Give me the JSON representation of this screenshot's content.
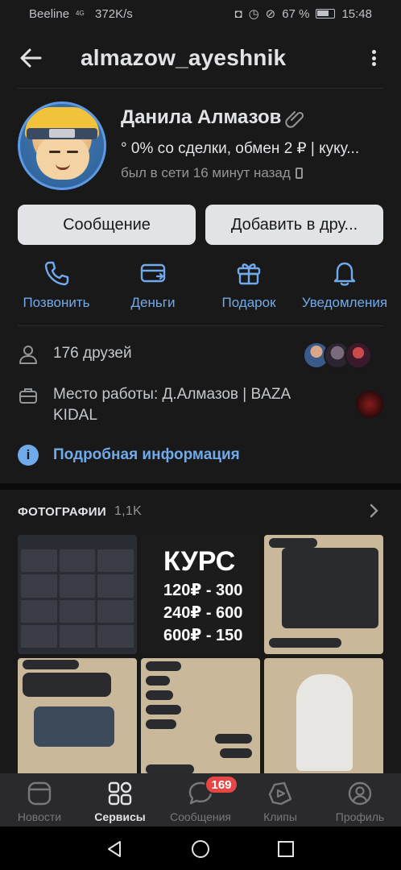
{
  "status_bar": {
    "carrier": "Beeline",
    "network": "4G",
    "speed": "372K/s",
    "battery": "67 %",
    "time": "15:48"
  },
  "header": {
    "title": "almazow_ayeshnik"
  },
  "profile": {
    "name": "Данила Алмазов",
    "status": "° 0% со сделки, обмен 2 ₽ | куку...",
    "last_seen": "был в сети 16 минут назад"
  },
  "buttons": {
    "message": "Сообщение",
    "add_friend": "Добавить в дру..."
  },
  "actions": [
    {
      "label": "Позвонить",
      "icon": "phone-icon"
    },
    {
      "label": "Деньги",
      "icon": "money-icon"
    },
    {
      "label": "Подарок",
      "icon": "gift-icon"
    },
    {
      "label": "Уведомления",
      "icon": "bell-icon"
    }
  ],
  "info": {
    "friends": "176 друзей",
    "work": "Место работы: Д.Алмазов | BAZA KIDAL",
    "details_link": "Подробная информация"
  },
  "photos": {
    "heading": "ФОТОГРАФИИ",
    "count": "1,1K",
    "tile2_title": "КУРС",
    "tile2_prices": [
      "120₽ - 300",
      "240₽ - 600",
      "600₽ - 150"
    ]
  },
  "tabbar": {
    "items": [
      {
        "label": "Новости",
        "icon": "news-icon"
      },
      {
        "label": "Сервисы",
        "icon": "services-icon"
      },
      {
        "label": "Сообщения",
        "icon": "messages-icon"
      },
      {
        "label": "Клипы",
        "icon": "clips-icon"
      },
      {
        "label": "Профиль",
        "icon": "profile-icon"
      }
    ],
    "active": "Сервисы",
    "messages_badge": "169"
  },
  "colors": {
    "background": "#19191a",
    "accent": "#71aaeb",
    "badge": "#e64646"
  }
}
